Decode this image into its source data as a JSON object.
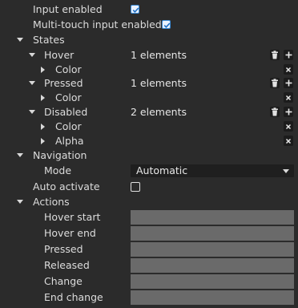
{
  "input_enabled": {
    "label": "Input enabled",
    "checked": true
  },
  "multitouch": {
    "label": "Multi-touch input enabled",
    "checked": true
  },
  "states": {
    "label": "States",
    "hover": {
      "label": "Hover",
      "count": "1 elements",
      "children": [
        "Color"
      ]
    },
    "pressed": {
      "label": "Pressed",
      "count": "1 elements",
      "children": [
        "Color"
      ]
    },
    "disabled": {
      "label": "Disabled",
      "count": "2 elements",
      "children": [
        "Color",
        "Alpha"
      ]
    }
  },
  "navigation": {
    "label": "Navigation",
    "mode_label": "Mode",
    "mode_value": "Automatic"
  },
  "auto_activate": {
    "label": "Auto activate",
    "checked": false
  },
  "actions": {
    "label": "Actions",
    "items": [
      "Hover start",
      "Hover end",
      "Pressed",
      "Released",
      "Change",
      "End change"
    ]
  },
  "icons": {
    "delete": "trash-icon",
    "add": "plus-icon",
    "remove": "x-icon"
  },
  "colors": {
    "background": "#2b2b2b",
    "accent": "#3c8cd8",
    "field": "#6a6a6a",
    "button": "#1c1c1c"
  }
}
